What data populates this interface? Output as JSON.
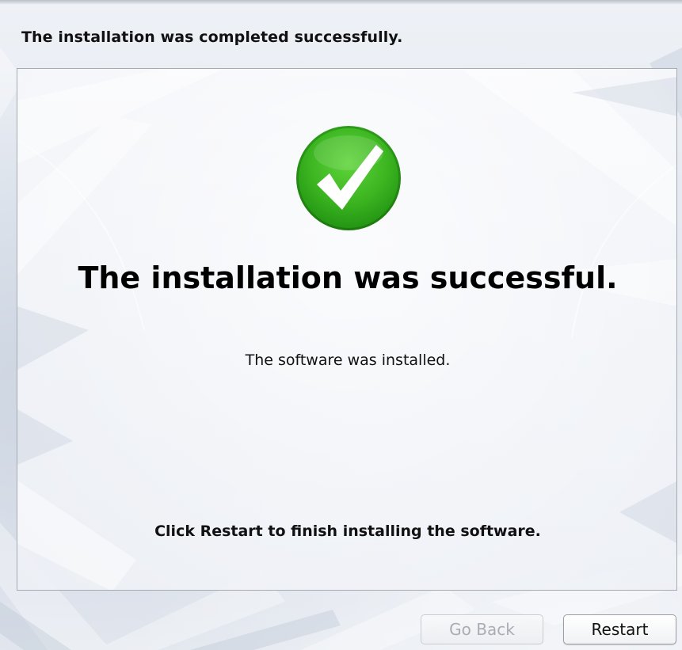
{
  "header": {
    "heading": "The installation was completed successfully."
  },
  "panel": {
    "status_icon": "green-checkmark-icon",
    "title": "The installation was successful.",
    "subtitle": "The software was installed.",
    "instruction": "Click Restart to finish installing the software."
  },
  "buttons": {
    "go_back": {
      "label": "Go Back",
      "enabled": false
    },
    "restart": {
      "label": "Restart",
      "enabled": true
    }
  },
  "colors": {
    "success_green": "#3cb521",
    "background": "#e3e8f0"
  }
}
